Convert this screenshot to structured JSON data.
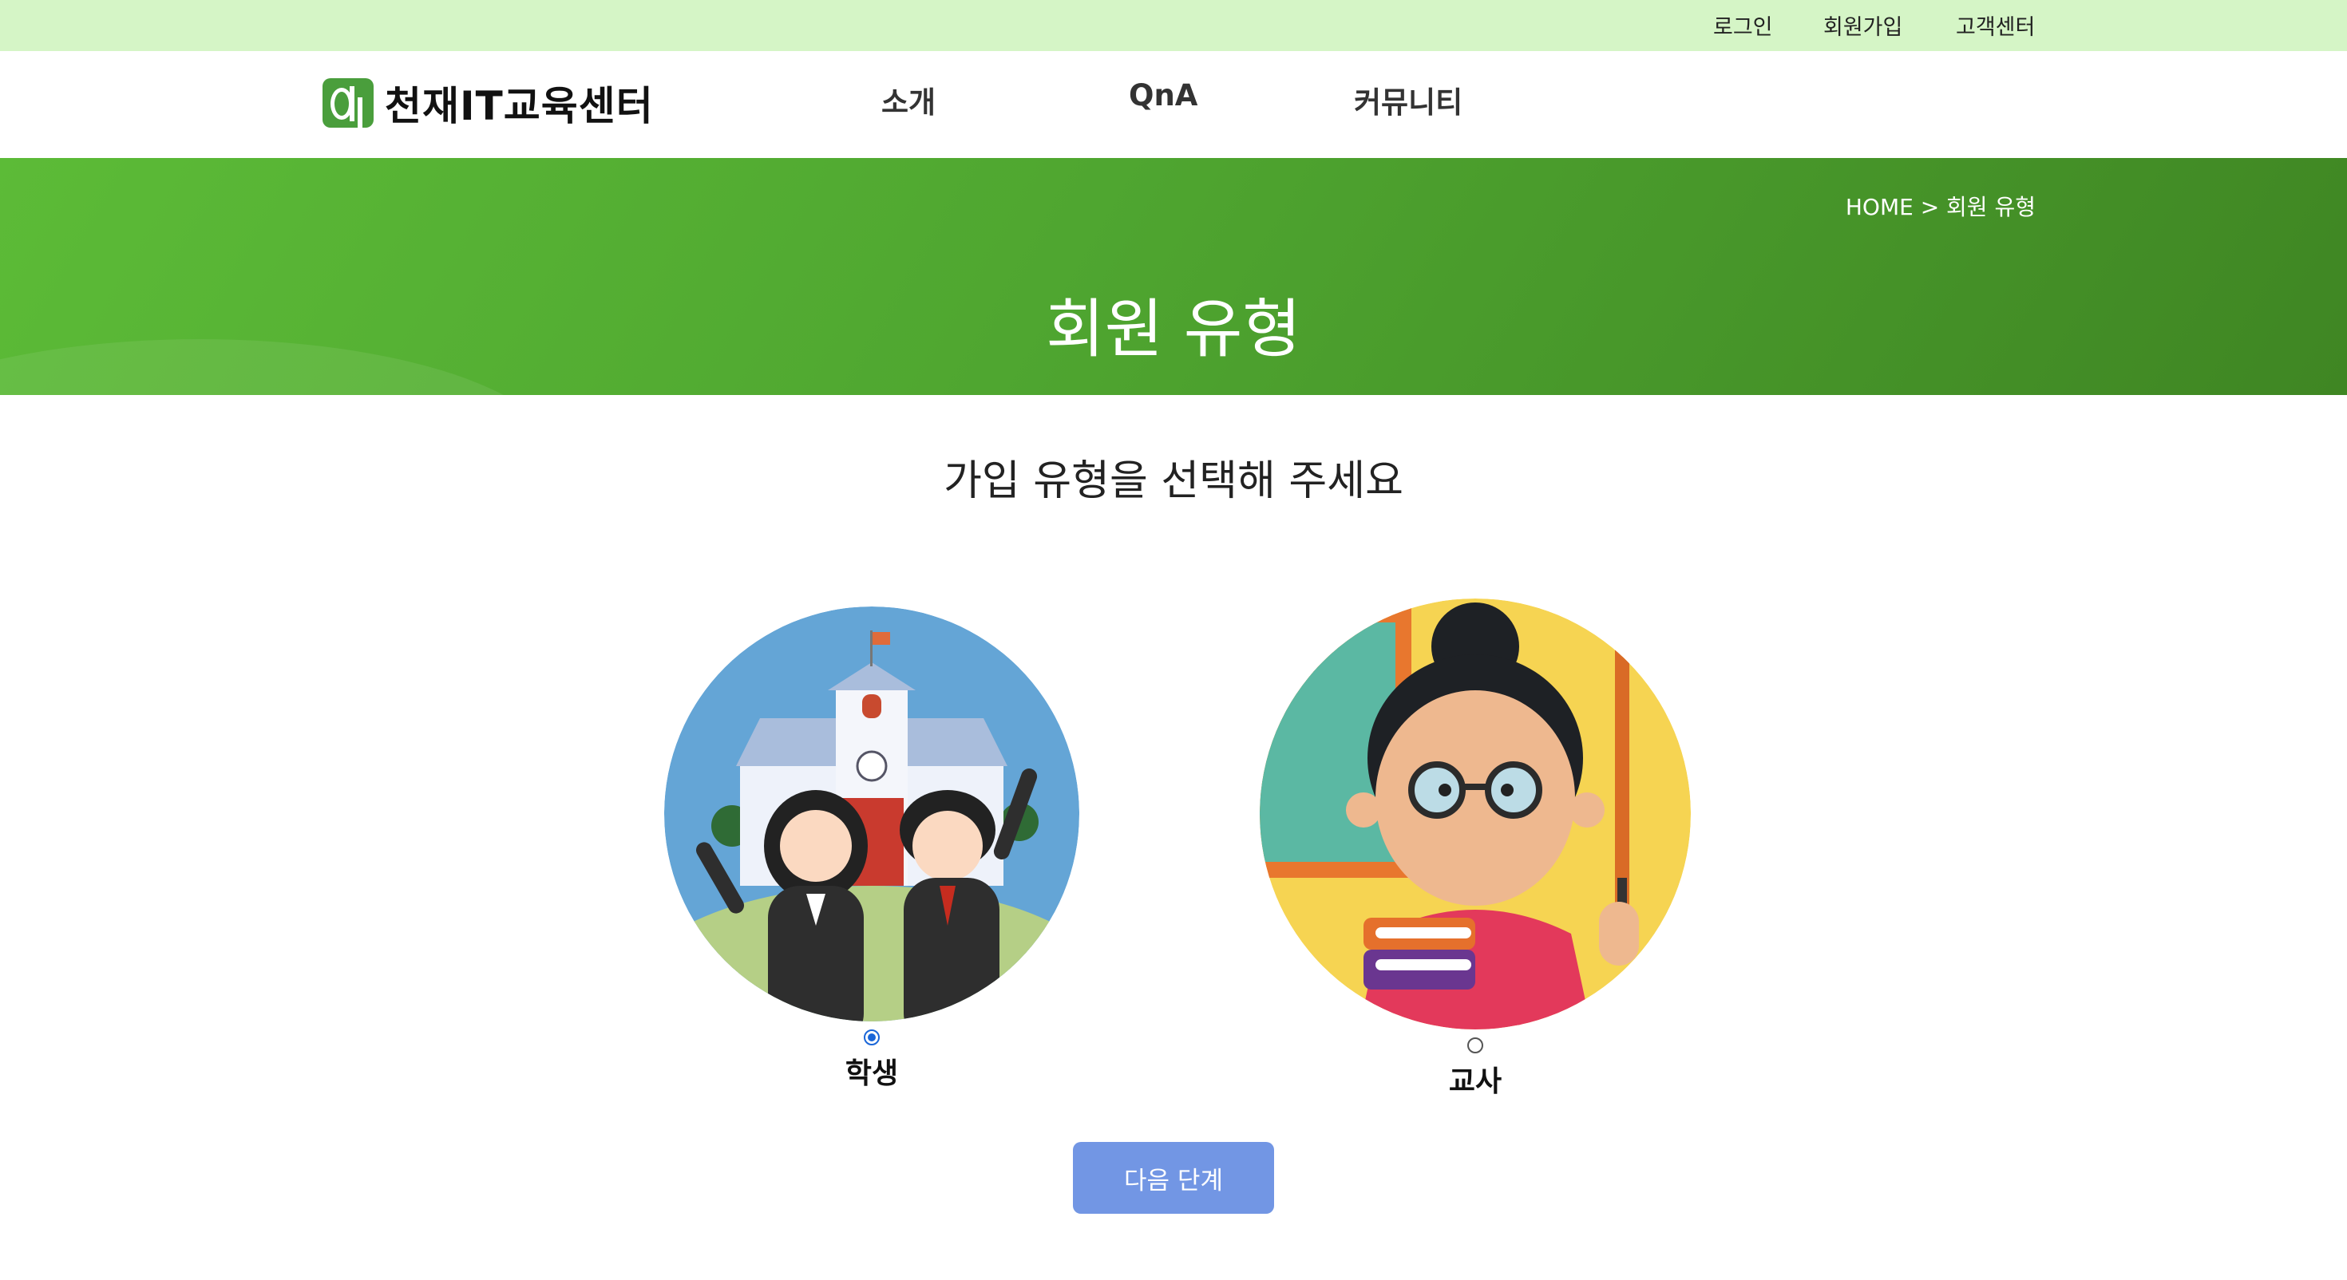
{
  "top_links": {
    "login": "로그인",
    "signup": "회원가입",
    "support": "고객센터"
  },
  "header": {
    "logo_text": "천재IT교육센터",
    "nav": {
      "intro": "소개",
      "qna": "QnA",
      "community": "커뮤니티"
    }
  },
  "banner": {
    "breadcrumb": "HOME > 회원 유형",
    "title": "회원 유형"
  },
  "main": {
    "subtitle": "가입 유형을 선택해 주세요",
    "options": [
      {
        "label": "학생",
        "checked": true,
        "illustration": "students-at-school-illustration"
      },
      {
        "label": "교사",
        "checked": false,
        "illustration": "teacher-with-pointer-illustration"
      }
    ],
    "next_button": "다음 단계"
  },
  "colors": {
    "topbar": "#d5f5c6",
    "banner_green": "#4fa630",
    "button_blue": "#7296e4",
    "radio_blue": "#1a66d8"
  }
}
